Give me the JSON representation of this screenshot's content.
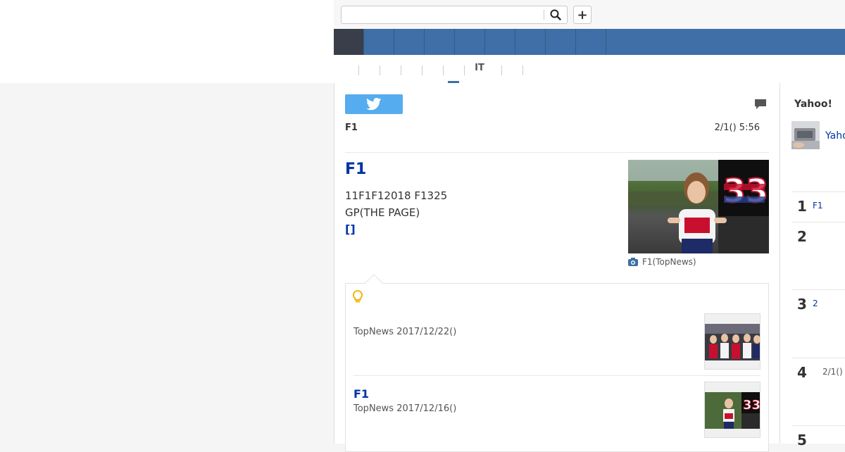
{
  "header": {
    "search": {
      "value": "",
      "placeholder": ""
    },
    "search_icon": "search-icon",
    "add_icon": "plus-icon",
    "add_label": "+"
  },
  "nav": {
    "items": [
      "",
      "",
      "",
      "",
      "",
      "",
      "",
      "",
      ""
    ],
    "active_index": 0
  },
  "subnav": {
    "items": [
      "",
      "",
      "",
      "",
      "",
      "IT",
      ""
    ],
    "active_label": "IT"
  },
  "article": {
    "share": {
      "icon": "twitter-icon"
    },
    "comment_icon": "comment-icon",
    "source": "F1",
    "date": "2/1() 5:56",
    "title": "F1",
    "body_line1": "11F1F12018 F1325",
    "body_line2": "GP(THE PAGE)",
    "more": "[]",
    "photo": {
      "alt": "grid girl in dirndl with car number 33"
    },
    "caption": "F1(TopNews)"
  },
  "related": {
    "icon": "lightbulb-icon",
    "items": [
      {
        "title": "",
        "meta": "TopNews 2017/12/22()"
      },
      {
        "title": "F1",
        "meta": "TopNews 2017/12/16()"
      }
    ]
  },
  "sidebar": {
    "title": "Yahoo!",
    "link": "Yaho",
    "ranking": [
      {
        "rank": "1",
        "text": "F1"
      },
      {
        "rank": "2",
        "text": ""
      },
      {
        "rank": "3",
        "text": "2"
      },
      {
        "rank": "4",
        "text": "2/1()"
      },
      {
        "rank": "5",
        "text": ""
      }
    ]
  },
  "colors": {
    "nav_blue": "#3f6fa6",
    "nav_active": "#3a3e4a",
    "link_blue": "#0033a5",
    "twitter_blue": "#55acee",
    "bulb_yellow": "#f0b400"
  }
}
